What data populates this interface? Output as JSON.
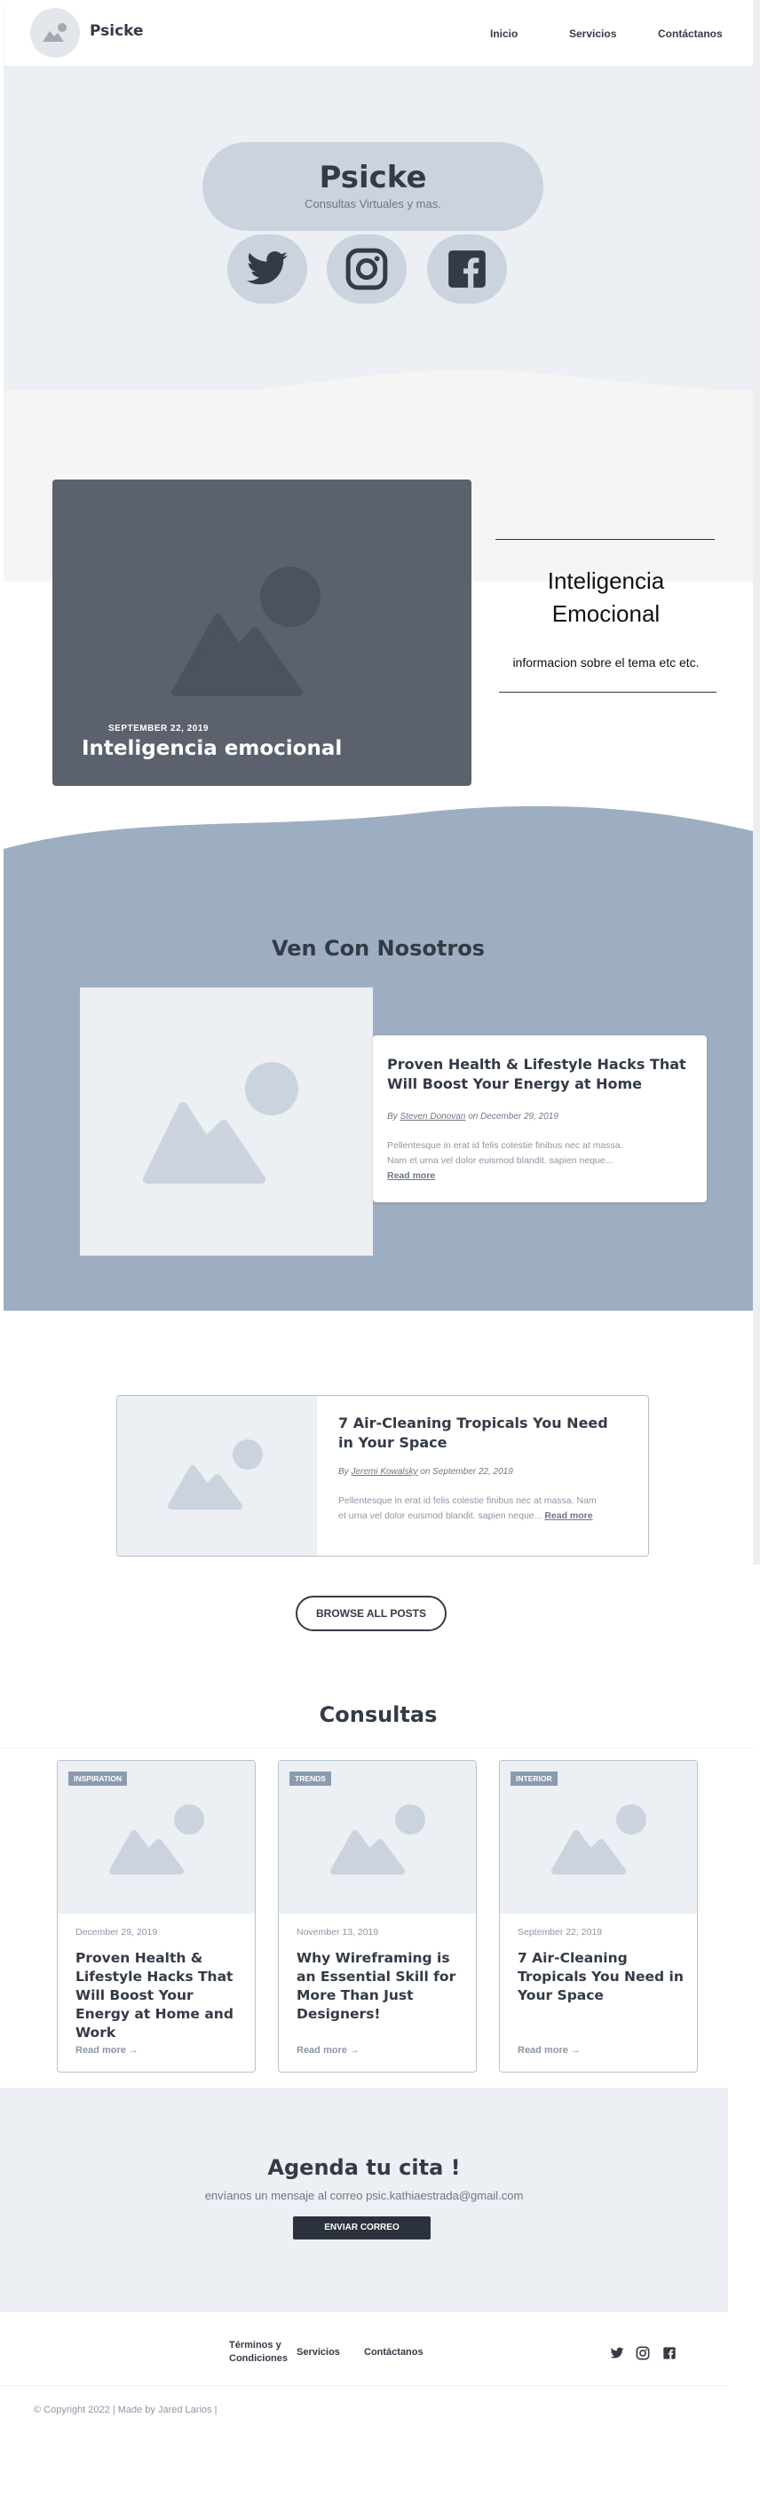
{
  "header": {
    "brand": "Psicke",
    "nav": [
      "Inicio",
      "Servicios",
      "Contáctanos"
    ]
  },
  "hero": {
    "title": "Psicke",
    "subtitle": "Consultas Virtuales y mas.",
    "social_icons": [
      "twitter-icon",
      "instagram-icon",
      "facebook-icon"
    ]
  },
  "featured": {
    "date": "SEPTEMBER 22, 2019",
    "title": "Inteligencia emocional",
    "side_title": "Inteligencia Emocional",
    "side_desc": "informacion sobre el tema etc etc."
  },
  "ven": {
    "heading": "Ven Con Nosotros",
    "post": {
      "title": "Proven Health & Lifestyle Hacks That Will Boost Your Energy at Home",
      "by": "By",
      "author": "Steven Donovan",
      "on_date": "on December 29, 2019",
      "excerpt": "Pellentesque in erat id felis colestie finibus nec at massa. Nam et urna vel dolor euismod blandit. sapien neque...",
      "read_more": "Read more"
    }
  },
  "air": {
    "title": "7 Air-Cleaning Tropicals You Need in Your Space",
    "by": "By",
    "author": "Jeremi Kowalsky",
    "on_date": "on September 22, 2019",
    "excerpt": "Pellentesque in erat id felis colestie finibus nec at massa. Nam et urna vel dolor euismod blandit. sapien neque...",
    "read_more": "Read more"
  },
  "browse_label": "BROWSE ALL POSTS",
  "consultas": {
    "heading": "Consultas",
    "cards": [
      {
        "badge": "INSPIRATION",
        "date": "December 29, 2019",
        "title": "Proven Health & Lifestyle Hacks That Will Boost Your Energy at Home and Work",
        "read": "Read more →"
      },
      {
        "badge": "TRENDS",
        "date": "November 13, 2019",
        "title": "Why Wireframing is an Essential Skill for More Than Just Designers!",
        "read": "Read more →"
      },
      {
        "badge": "INTERIOR",
        "date": "September 22, 2019",
        "title": "7 Air-Cleaning Tropicals You Need in Your Space",
        "read": "Read more →"
      }
    ]
  },
  "cita": {
    "title": "Agenda tu cita !",
    "subtitle": "envíanos un mensaje al correo psic.kathiaestrada@gmail.com",
    "button": "ENVIAR CORREO"
  },
  "footer": {
    "links": [
      "Términos y Condiciones",
      "Servicios",
      "Contáctanos"
    ],
    "copyright": "© Copyright 2022 | Made by Jared Larios |"
  }
}
